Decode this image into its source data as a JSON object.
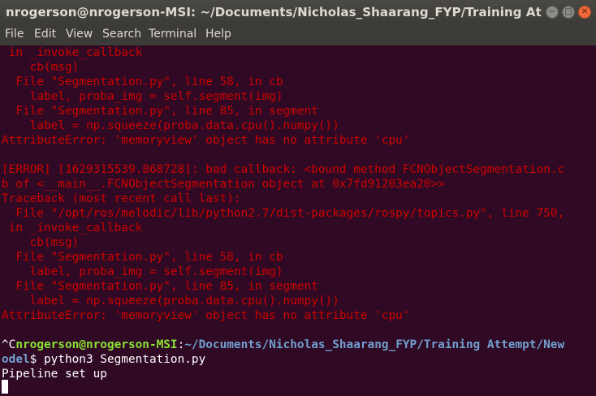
{
  "window": {
    "title": "nrogerson@nrogerson-MSI: ~/Documents/Nicholas_Shaarang_FYP/Training Attempt/New ...",
    "min_icon": "−",
    "max_icon": "□",
    "close_icon": "✕"
  },
  "menu": [
    "File",
    "Edit",
    "View",
    "Search",
    "Terminal",
    "Help"
  ],
  "output": [
    " in _invoke_callback",
    "    cb(msg)",
    "  File \"Segmentation.py\", line 58, in cb",
    "    label, proba_img = self.segment(img)",
    "  File \"Segmentation.py\", line 85, in segment",
    "    label = np.squeeze(proba.data.cpu().numpy())",
    "AttributeError: 'memoryview' object has no attribute 'cpu'",
    "",
    "[ERROR] [1629315539.868728]: bad callback: <bound method FCNObjectSegmentation.c",
    "b of <__main__.FCNObjectSegmentation object at 0x7fd91203ea20>>",
    "Traceback (most recent call last):",
    "  File \"/opt/ros/melodic/lib/python2.7/dist-packages/rospy/topics.py\", line 750,",
    " in _invoke_callback",
    "    cb(msg)",
    "  File \"Segmentation.py\", line 58, in cb",
    "    label, proba_img = self.segment(img)",
    "  File \"Segmentation.py\", line 85, in segment",
    "    label = np.squeeze(proba.data.cpu().numpy())",
    "AttributeError: 'memoryview' object has no attribute 'cpu'"
  ],
  "prompt": {
    "interrupt": "^C",
    "user_host": "nrogerson@nrogerson-MSI",
    "colon": ":",
    "path_line1": "~/Documents/Nicholas_Shaarang_FYP/Training Attempt/New",
    "path_line2": "odel",
    "dollar": "$ ",
    "command": "python3 Segmentation.py"
  },
  "status_line": "Pipeline set up",
  "colors": {
    "background": "#300a24",
    "error": "#cc0000",
    "user": "#8ae234",
    "path": "#729fcf"
  }
}
